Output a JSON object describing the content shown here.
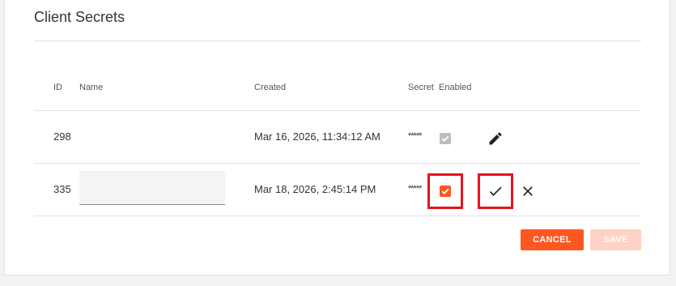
{
  "section": {
    "title": "Client Secrets"
  },
  "table": {
    "headers": {
      "id": "ID",
      "name": "Name",
      "created": "Created",
      "secret": "Secret",
      "enabled": "Enabled"
    },
    "rows": [
      {
        "id": "298",
        "name": "",
        "created": "Mar 16, 2026, 11:34:12 AM",
        "secret": "*****",
        "enabled": true,
        "mode": "view"
      },
      {
        "id": "335",
        "name": "",
        "created": "Mar 18, 2026, 2:45:14 PM",
        "secret": "*****",
        "enabled": true,
        "mode": "edit"
      }
    ]
  },
  "actions": {
    "cancel_label": "CANCEL",
    "save_label": "SAVE"
  },
  "colors": {
    "accent": "#ff5722",
    "accent_disabled": "#ffd3c4",
    "checkbox_disabled": "#bdbdbd",
    "highlight": "#e3141e"
  },
  "icons": {
    "row1_action": "pencil-icon",
    "row2_confirm": "check-icon",
    "row2_cancel": "close-icon"
  }
}
